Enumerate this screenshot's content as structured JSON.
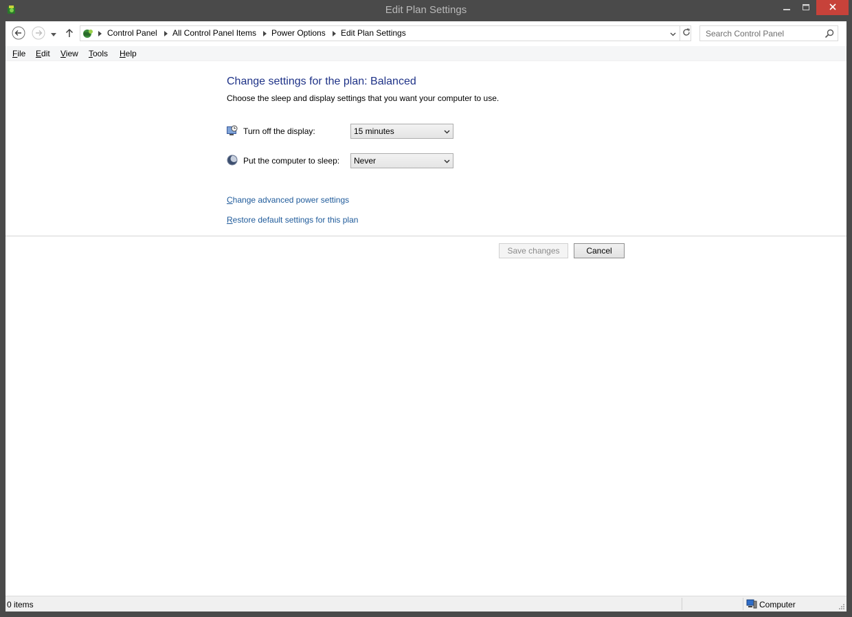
{
  "window": {
    "title": "Edit Plan Settings"
  },
  "address_bar": {
    "breadcrumbs": [
      "Control Panel",
      "All Control Panel Items",
      "Power Options",
      "Edit Plan Settings"
    ]
  },
  "search": {
    "placeholder": "Search Control Panel"
  },
  "menu": {
    "items": [
      {
        "accel": "F",
        "rest": "ile"
      },
      {
        "accel": "E",
        "rest": "dit"
      },
      {
        "accel": "V",
        "rest": "iew"
      },
      {
        "accel": "T",
        "rest": "ools"
      },
      {
        "accel": "H",
        "rest": "elp"
      }
    ]
  },
  "main": {
    "heading": "Change settings for the plan: Balanced",
    "subtext": "Choose the sleep and display settings that you want your computer to use.",
    "display_label": "Turn off the display:",
    "display_value": "15 minutes",
    "sleep_label": "Put the computer to sleep:",
    "sleep_value": "Never",
    "advanced_link_accel": "C",
    "advanced_link_rest": "hange advanced power settings",
    "restore_link_accel": "R",
    "restore_link_rest": "estore default settings for this plan",
    "save_label": "Save changes",
    "cancel_label": "Cancel"
  },
  "status": {
    "left": "0 items",
    "right": "Computer"
  },
  "colors": {
    "heading": "#1e3287",
    "link": "#1e5a9a",
    "close_button": "#c7423a",
    "title_bar": "#4a4a4a"
  },
  "icons": [
    "app-power-icon",
    "back-icon",
    "forward-icon",
    "recent-dropdown-icon",
    "up-icon",
    "control-panel-icon",
    "search-icon",
    "refresh-icon",
    "monitor-clock-icon",
    "moon-icon",
    "computer-icon",
    "minimize-icon",
    "maximize-icon",
    "close-icon"
  ]
}
